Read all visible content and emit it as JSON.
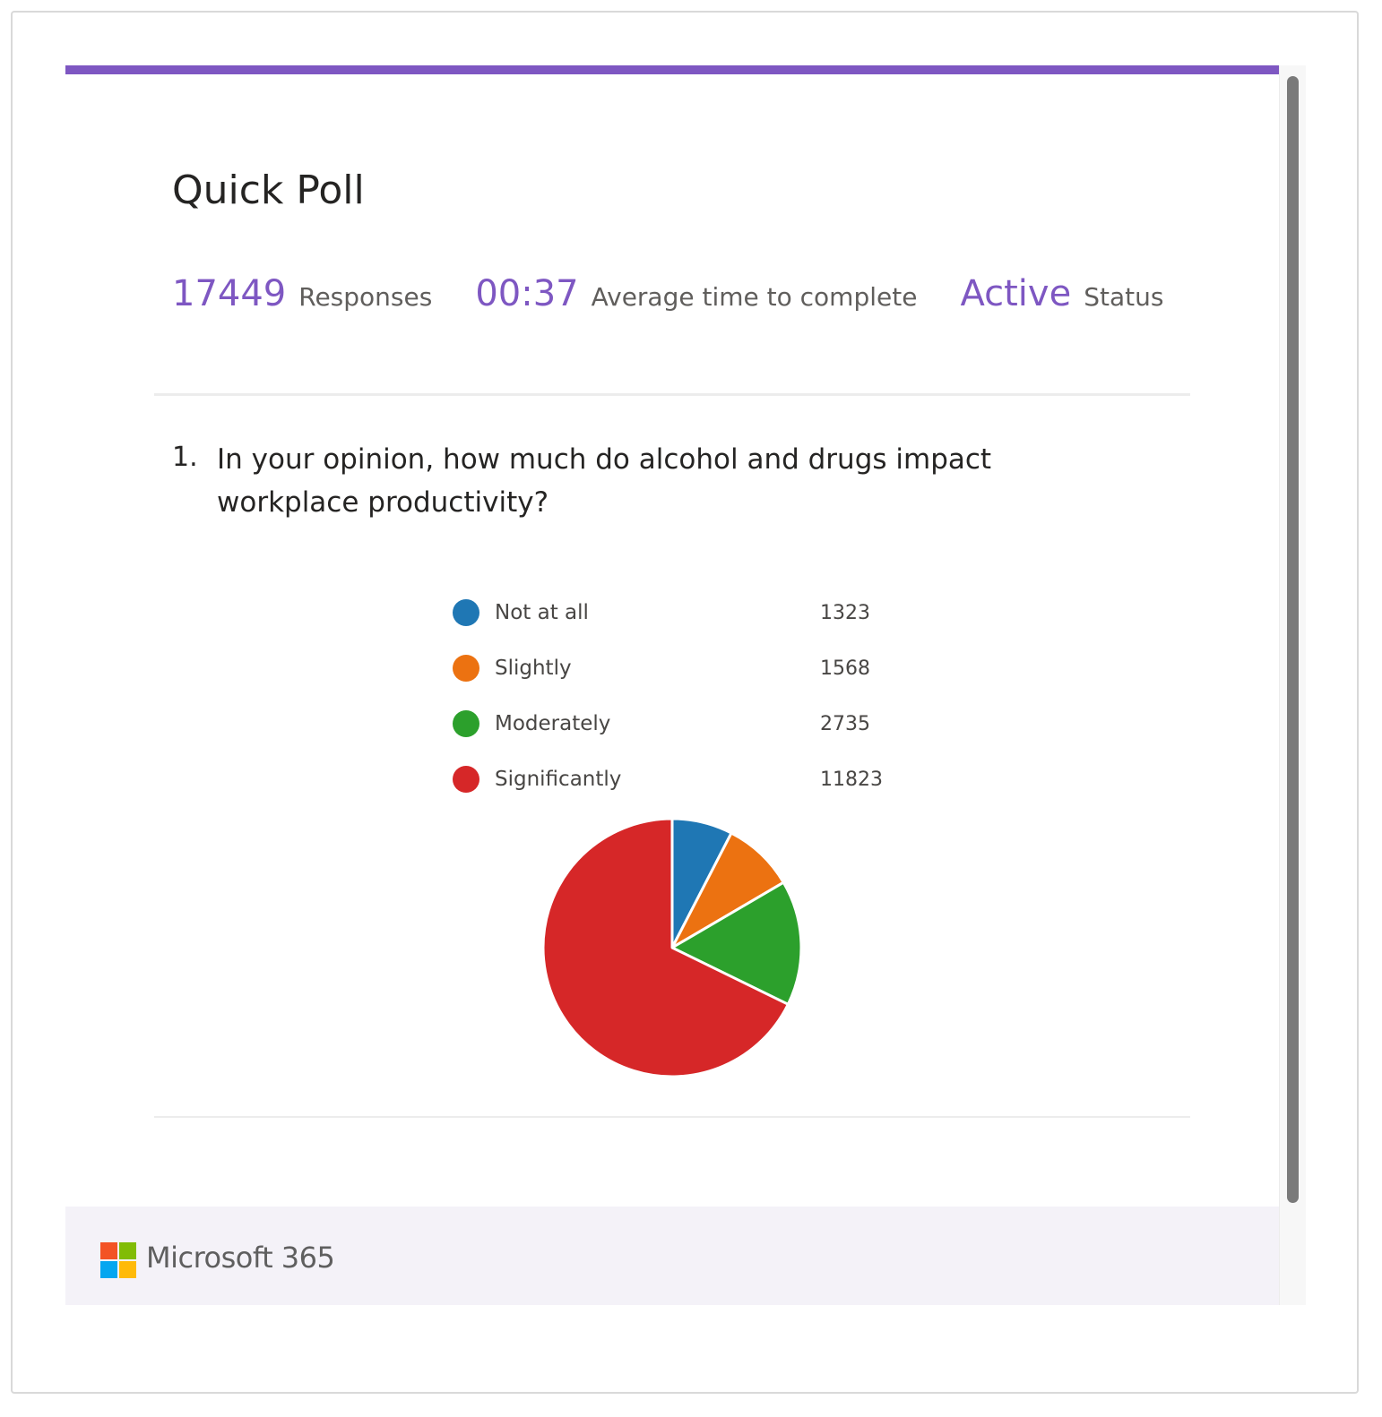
{
  "poll": {
    "title": "Quick Poll",
    "accent_color": "#7e57c2"
  },
  "stats": [
    {
      "value": "17449",
      "label": "Responses"
    },
    {
      "value": "00:37",
      "label": "Average time to complete"
    },
    {
      "value": "Active",
      "label": "Status"
    }
  ],
  "question": {
    "number": "1.",
    "text": "In your opinion, how much do alcohol and drugs impact workplace productivity?"
  },
  "chart_data": {
    "type": "pie",
    "categories": [
      "Not at all",
      "Slightly",
      "Moderately",
      "Significantly"
    ],
    "values": [
      1323,
      1568,
      2735,
      11823
    ],
    "colors": [
      "#1f77b4",
      "#ec7211",
      "#2ca02c",
      "#d62728"
    ],
    "legend": "top"
  },
  "footer": {
    "brand": "Microsoft 365",
    "logo_colors": [
      "#f35325",
      "#81bc06",
      "#05a6f0",
      "#ffba08"
    ]
  },
  "icons": [
    "microsoft-logo-icon"
  ]
}
